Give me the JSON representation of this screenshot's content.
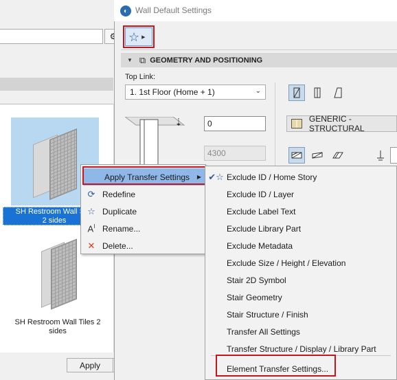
{
  "favorites_palette": {
    "items": [
      {
        "label_line1": "SH Restroom Wall Sha",
        "label_line2": "2 sides",
        "selected": true
      },
      {
        "label_line1": "SH Restroom Wall Tiles 2",
        "label_line2": "sides",
        "selected": false
      }
    ],
    "apply_label": "Apply"
  },
  "dialog": {
    "title": "Wall Default Settings",
    "section_title": "GEOMETRY AND POSITIONING",
    "top_link_label": "Top Link:",
    "top_link_value": "1. 1st Floor (Home + 1)",
    "offset_value": "0",
    "height_value": "4300",
    "structure_value": "GENERIC - STRUCTURAL"
  },
  "context_menu": {
    "items": [
      {
        "label": "Apply Transfer Settings",
        "icon": "none",
        "has_submenu": true,
        "highlighted": true
      },
      {
        "label": "Redefine",
        "icon": "star-refresh-icon"
      },
      {
        "label": "Duplicate",
        "icon": "star-outline-icon"
      },
      {
        "label": "Rename...",
        "icon": "text-cursor-icon"
      },
      {
        "label": "Delete...",
        "icon": "red-x-icon"
      }
    ]
  },
  "submenu": {
    "items": [
      {
        "label": "Exclude ID / Home Story",
        "checked": true
      },
      {
        "label": "Exclude ID / Layer",
        "checked": false
      },
      {
        "label": "Exclude Label Text",
        "checked": false
      },
      {
        "label": "Exclude Library Part",
        "checked": false
      },
      {
        "label": "Exclude Metadata",
        "checked": false
      },
      {
        "label": "Exclude Size / Height / Elevation",
        "checked": false
      },
      {
        "label": "Stair 2D Symbol",
        "checked": false
      },
      {
        "label": "Stair Geometry",
        "checked": false
      },
      {
        "label": "Stair Structure / Finish",
        "checked": false
      },
      {
        "label": "Transfer All Settings",
        "checked": false
      },
      {
        "label": "Transfer Structure / Display / Library Part",
        "checked": false
      },
      {
        "label": "Element Transfer Settings...",
        "checked": false
      }
    ]
  },
  "colors": {
    "selection_blue": "#1a73d4",
    "menu_highlight": "#8fb8e8",
    "annotation_red": "#c4161c"
  }
}
